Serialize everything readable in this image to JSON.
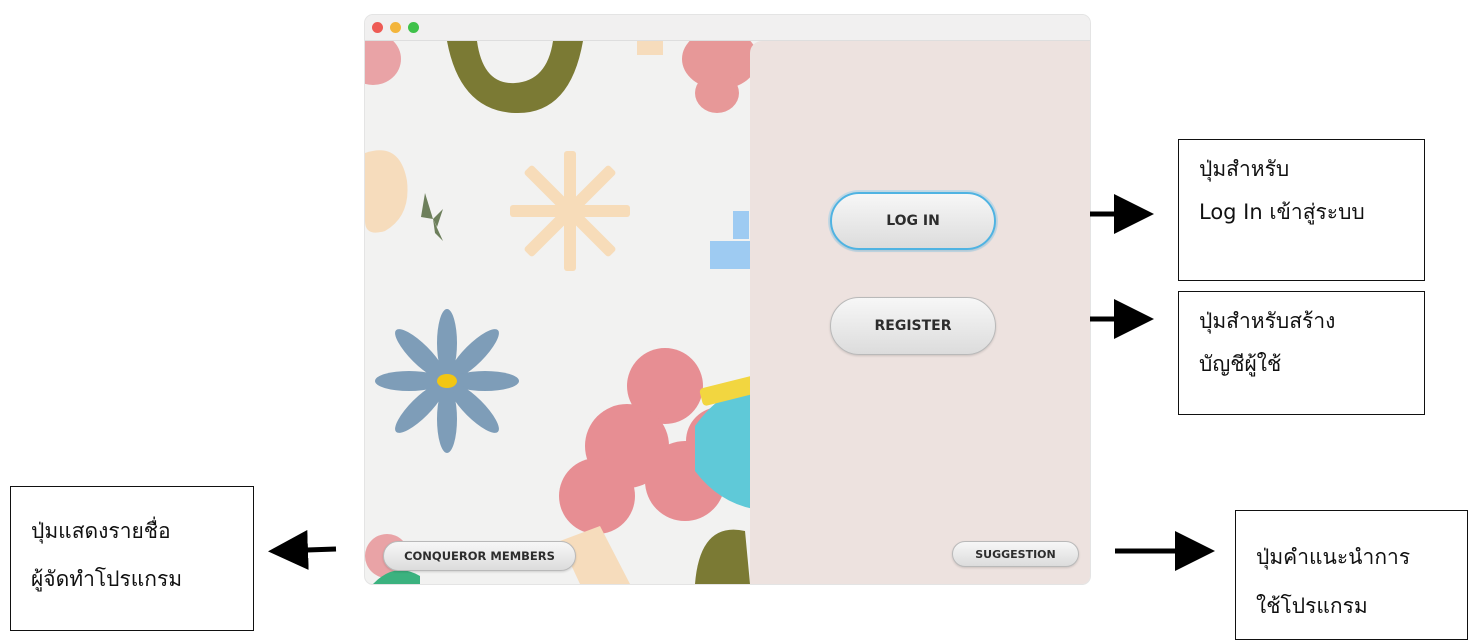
{
  "window": {
    "controls": [
      "close",
      "minimize",
      "maximize"
    ]
  },
  "buttons": {
    "login": "LOG IN",
    "register": "REGISTER",
    "members": "CONQUEROR MEMBERS",
    "suggestion": "SUGGESTION"
  },
  "annotations": {
    "login": [
      "ปุ่มสำหรับ",
      "Log In เข้าสู่ระบบ"
    ],
    "register": [
      "ปุ่มสำหรับสร้าง",
      "บัญชีผู้ใช้"
    ],
    "members": [
      "ปุ่มแสดงรายชื่อ",
      "ผู้จัดทำโปรแกรม"
    ],
    "suggestion": [
      "ปุ่มคำแนะนำการ",
      "ใช้โปรแกรม"
    ]
  },
  "colors": {
    "panel": "#ede2df",
    "accent_focus": "#4fb3e2",
    "pink": "#e79898",
    "olive": "#7d7a35",
    "peach": "#f6dcbc",
    "blue_flower": "#7e9db8",
    "yellow": "#f2d640",
    "cyan": "#5fc9d8"
  }
}
